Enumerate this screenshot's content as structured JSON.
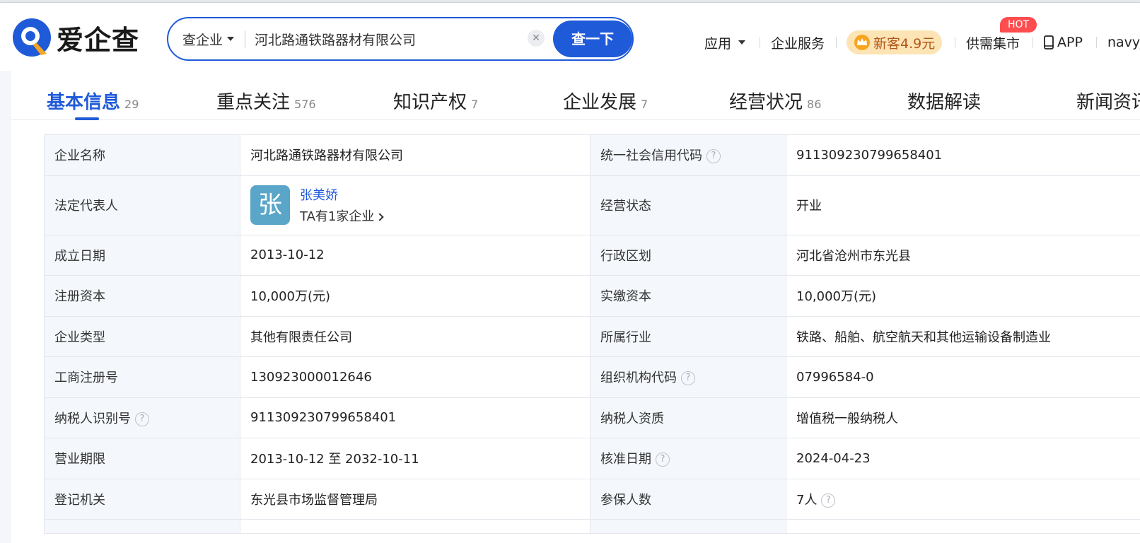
{
  "brand": {
    "name": "爱企查",
    "accent": "#1f5ad8",
    "logo_orange": "#f7a51e"
  },
  "search": {
    "type_label": "查企业",
    "query": "河北路通铁路器材有限公司",
    "clear_icon": "close-icon",
    "button_label": "查一下"
  },
  "nav": {
    "apps": "应用",
    "services": "企业服务",
    "promo": "新客4.9元",
    "market": "供需集市",
    "market_badge": "HOT",
    "app": "APP",
    "user": "navyj"
  },
  "tabs": [
    {
      "label": "基本信息",
      "count": "29"
    },
    {
      "label": "重点关注",
      "count": "576"
    },
    {
      "label": "知识产权",
      "count": "7"
    },
    {
      "label": "企业发展",
      "count": "7"
    },
    {
      "label": "经营状况",
      "count": "86"
    },
    {
      "label": "数据解读",
      "count": ""
    },
    {
      "label": "新闻资讯",
      "count": ""
    }
  ],
  "info": {
    "company_name_label": "企业名称",
    "company_name": "河北路通铁路器材有限公司",
    "credit_code_label": "统一社会信用代码",
    "credit_code": "911309230799658401",
    "legal_rep_label": "法定代表人",
    "legal_rep_avatar": "张",
    "legal_rep_name": "张美娇",
    "legal_rep_link": "TA有1家企业",
    "status_label": "经营状态",
    "status": "开业",
    "founded_label": "成立日期",
    "founded": "2013-10-12",
    "region_label": "行政区划",
    "region": "河北省沧州市东光县",
    "reg_capital_label": "注册资本",
    "reg_capital": "10,000万(元)",
    "paid_capital_label": "实缴资本",
    "paid_capital": "10,000万(元)",
    "type_label": "企业类型",
    "type": "其他有限责任公司",
    "industry_label": "所属行业",
    "industry": "铁路、船舶、航空航天和其他运输设备制造业",
    "biz_reg_no_label": "工商注册号",
    "biz_reg_no": "130923000012646",
    "org_code_label": "组织机构代码",
    "org_code": "07996584-0",
    "taxpayer_id_label": "纳税人识别号",
    "taxpayer_id": "911309230799658401",
    "taxpayer_qual_label": "纳税人资质",
    "taxpayer_qual": "增值税一般纳税人",
    "term_label": "营业期限",
    "term": "2013-10-12 至 2032-10-11",
    "approval_label": "核准日期",
    "approval": "2024-04-23",
    "authority_label": "登记机关",
    "authority": "东光县市场监督管理局",
    "insured_label": "参保人数",
    "insured": "7人"
  }
}
